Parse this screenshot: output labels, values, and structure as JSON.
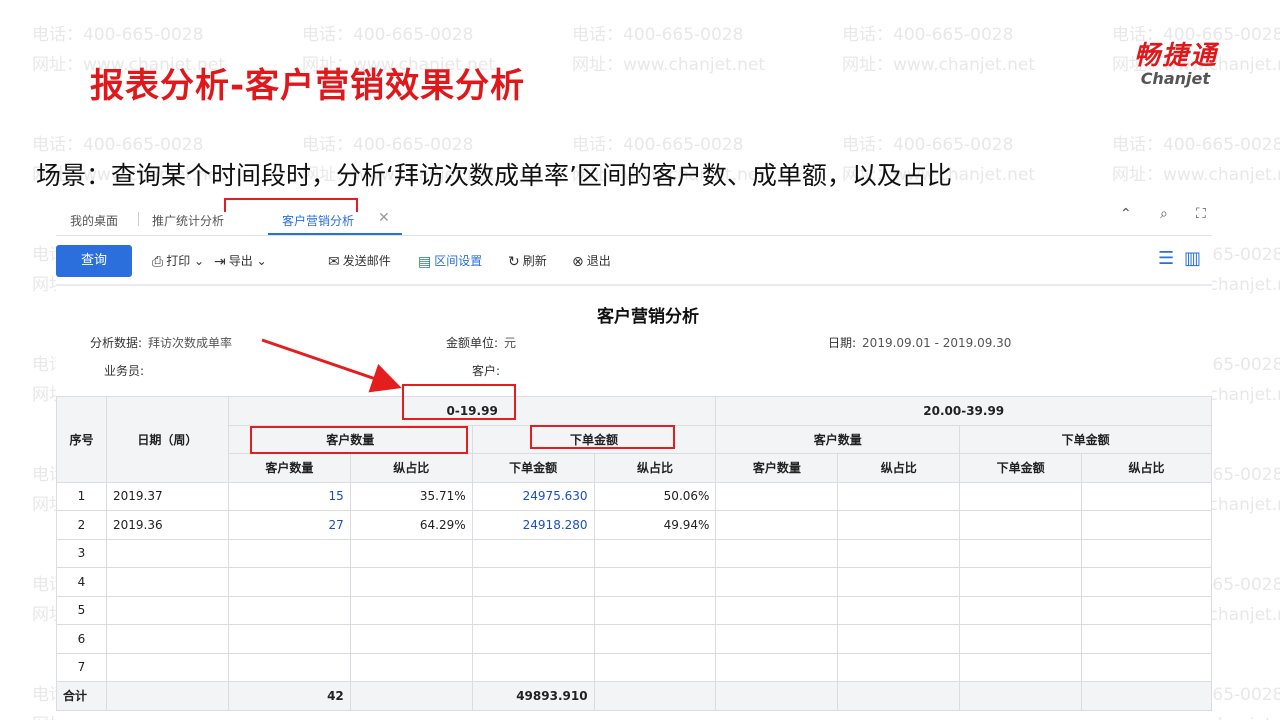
{
  "slide": {
    "title": "报表分析-客户营销效果分析",
    "scenario": "场景：查询某个时间段时，分析‘拜访次数成单率’区间的客户数、成单额，以及占比"
  },
  "logo": {
    "cn": "畅捷通",
    "en": "Chanjet"
  },
  "watermark": {
    "phone": "电话：400-665-0028",
    "site": "网址：www.chanjet.net"
  },
  "tabs": [
    {
      "label": "我的桌面"
    },
    {
      "label": "推广统计分析"
    },
    {
      "label": "客户营销分析",
      "active": true
    }
  ],
  "window_controls": [
    "⌃",
    "⌕",
    "⛶"
  ],
  "toolbar": {
    "query": "查询",
    "print": "打印",
    "export": "导出",
    "email": "发送邮件",
    "range": "区间设置",
    "refresh": "刷新",
    "exit": "退出"
  },
  "report": {
    "title": "客户营销分析",
    "analysis_label": "分析数据:",
    "analysis_value": "拜访次数成单率",
    "unit_label": "金额单位:",
    "unit_value": "元",
    "date_label": "日期:",
    "date_value": "2019.09.01 - 2019.09.30",
    "salesman_label": "业务员:",
    "customer_label": "客户:"
  },
  "table": {
    "col_index": "序号",
    "col_date": "日期（周）",
    "groups": [
      "0-19.99",
      "20.00-39.99"
    ],
    "sub_groups": [
      "客户数量",
      "下单金额"
    ],
    "sub_cols": [
      "客户数量",
      "纵占比",
      "下单金额",
      "纵占比"
    ],
    "rows": [
      {
        "index": "1",
        "date": "2019.37",
        "g1_count": "15",
        "g1_count_pct": "35.71%",
        "g1_amount": "24975.630",
        "g1_amount_pct": "50.06%"
      },
      {
        "index": "2",
        "date": "2019.36",
        "g1_count": "27",
        "g1_count_pct": "64.29%",
        "g1_amount": "24918.280",
        "g1_amount_pct": "49.94%"
      },
      {
        "index": "3"
      },
      {
        "index": "4"
      },
      {
        "index": "5"
      },
      {
        "index": "6"
      },
      {
        "index": "7"
      }
    ],
    "total": {
      "label": "合计",
      "g1_count": "42",
      "g1_amount": "49893.910"
    }
  },
  "colors": {
    "accent": "#2a6fdb",
    "title_red": "#e0181b",
    "highlight": "#e41e1e",
    "link": "#1a4fc4"
  }
}
